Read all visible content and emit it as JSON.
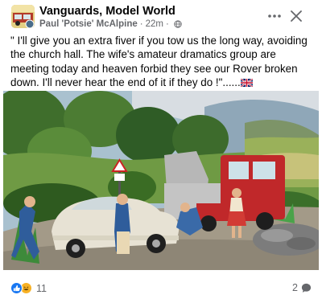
{
  "post": {
    "group_name": "Vanguards, Model World",
    "author": "Paul 'Potsie' McAlpine",
    "time": "22m",
    "separator": "·",
    "privacy_icon": "globe-icon",
    "more_icon": "more-options-icon",
    "close_icon": "close-icon",
    "text": "\" I'll give you an extra fiver if you tow us the long way, avoiding the church hall. The wife's amateur dramatics group are meeting today and heaven forbid they see our Rover broken down. I'll never hear the end of it if they do !\"......",
    "flag_icon": "uk-flag-icon",
    "photo_description_icon": "diorama-photo"
  },
  "footer": {
    "reactions": [
      "like-icon",
      "haha-icon"
    ],
    "reaction_count": "11",
    "comment_count": "2",
    "comment_icon": "comment-icon"
  },
  "colors": {
    "text": "#050505",
    "secondary": "#65676b",
    "like_blue": "#1877f2",
    "haha_yellow": "#f7b125"
  }
}
